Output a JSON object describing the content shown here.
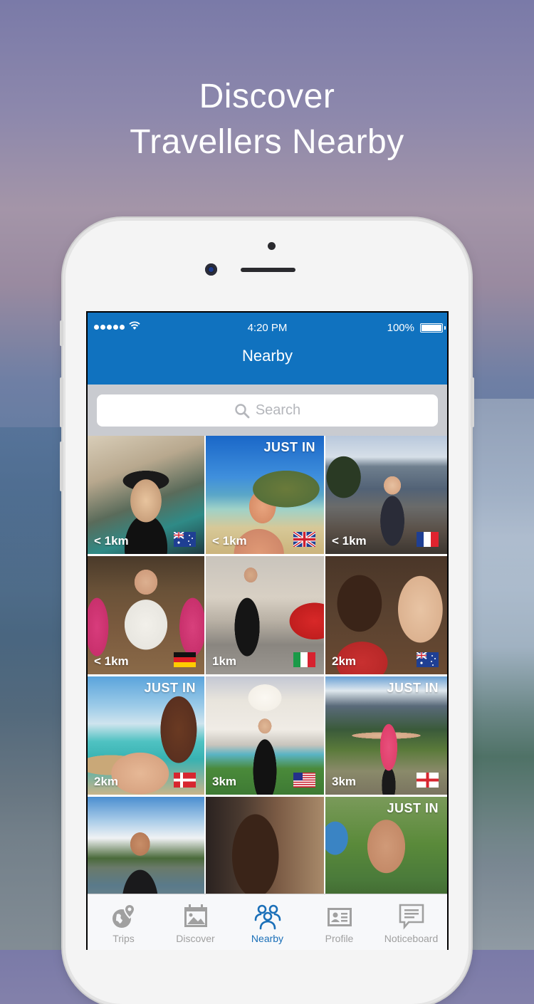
{
  "headline": {
    "line1": "Discover",
    "line2": "Travellers Nearby"
  },
  "status_bar": {
    "time": "4:20 PM",
    "battery": "100%",
    "signal_dots": 5
  },
  "navbar": {
    "title": "Nearby"
  },
  "search": {
    "placeholder": "Search"
  },
  "colors": {
    "nav_blue": "#1072bf",
    "active_tab": "#1a6fb8",
    "inactive_tab": "#a0a0a0"
  },
  "tiles": [
    {
      "distance": "< 1km",
      "just_in": "",
      "flag": "australia"
    },
    {
      "distance": "< 1km",
      "just_in": "JUST IN",
      "flag": "united-kingdom"
    },
    {
      "distance": "< 1km",
      "just_in": "",
      "flag": "france"
    },
    {
      "distance": "< 1km",
      "just_in": "",
      "flag": "germany"
    },
    {
      "distance": "1km",
      "just_in": "",
      "flag": "italy"
    },
    {
      "distance": "2km",
      "just_in": "",
      "flag": "australia"
    },
    {
      "distance": "2km",
      "just_in": "JUST IN",
      "flag": "denmark"
    },
    {
      "distance": "3km",
      "just_in": "",
      "flag": "united-states"
    },
    {
      "distance": "3km",
      "just_in": "JUST IN",
      "flag": "england"
    },
    {
      "distance": "",
      "just_in": "",
      "flag": ""
    },
    {
      "distance": "",
      "just_in": "",
      "flag": ""
    },
    {
      "distance": "",
      "just_in": "JUST IN",
      "flag": ""
    }
  ],
  "tabs": [
    {
      "label": "Trips",
      "icon": "globe-pin-icon",
      "active": false
    },
    {
      "label": "Discover",
      "icon": "calendar-image-icon",
      "active": false
    },
    {
      "label": "Nearby",
      "icon": "people-group-icon",
      "active": true
    },
    {
      "label": "Profile",
      "icon": "id-card-icon",
      "active": false
    },
    {
      "label": "Noticeboard",
      "icon": "message-board-icon",
      "active": false
    }
  ]
}
